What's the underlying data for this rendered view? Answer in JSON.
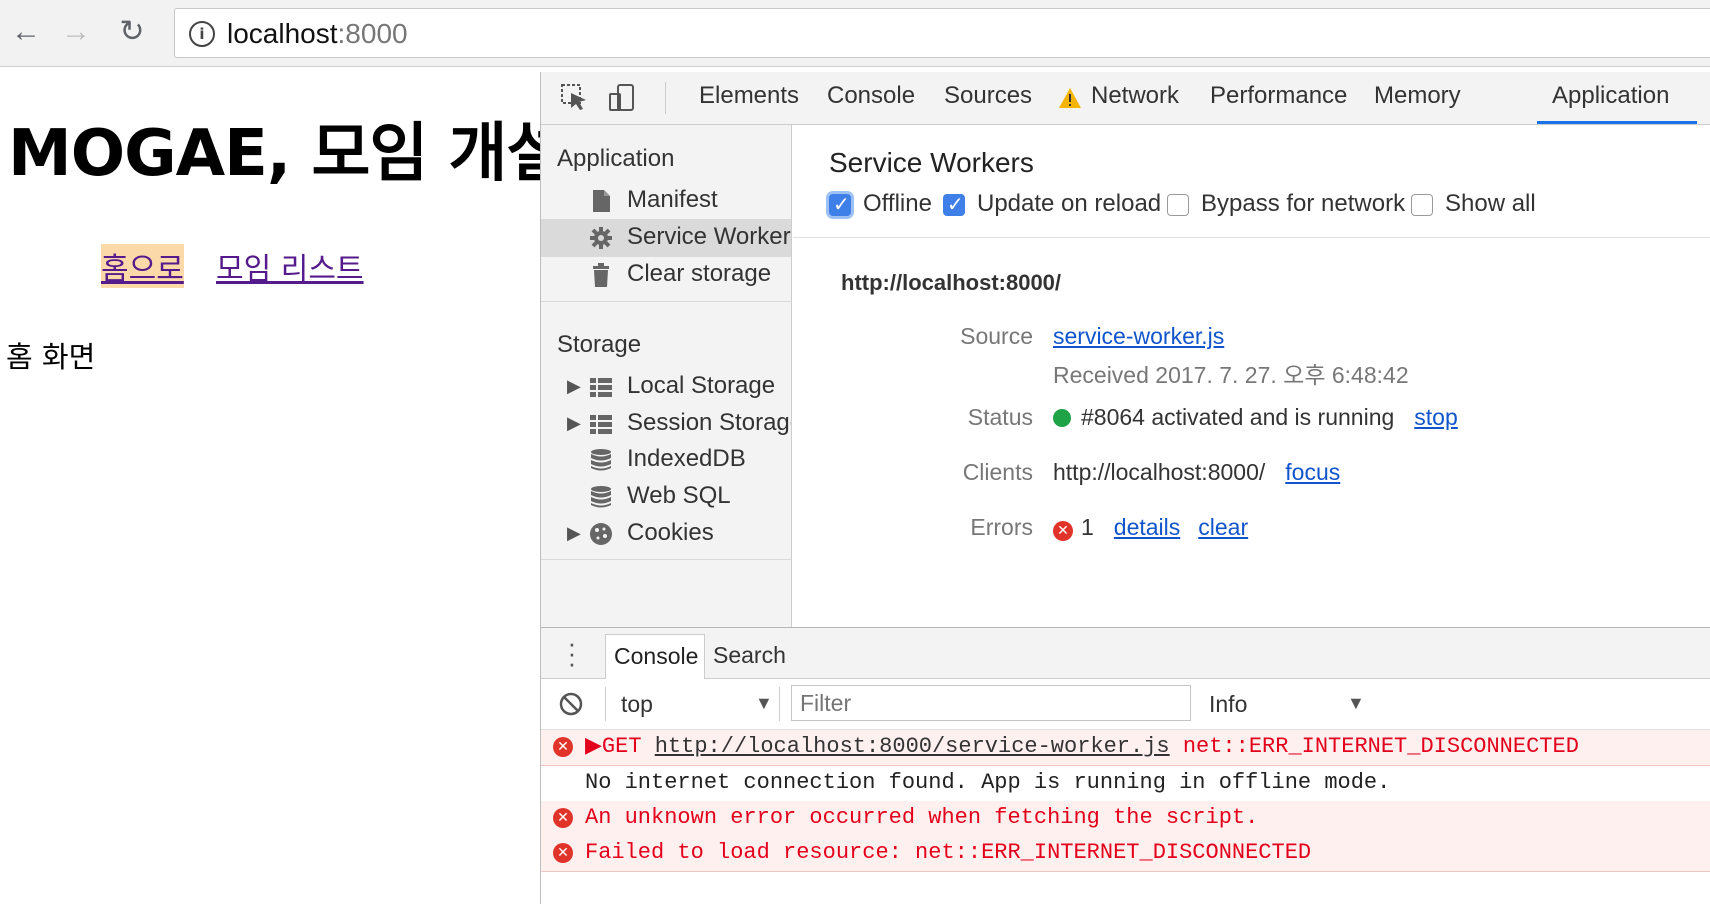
{
  "browser": {
    "url_host": "localhost",
    "url_port": ":8000"
  },
  "page": {
    "heading": "MOGAE, 모임 개설",
    "nav": [
      {
        "label": "홈으로"
      },
      {
        "label": "모임 리스트"
      }
    ],
    "body_text": "홈 화면"
  },
  "devtools": {
    "tabs": [
      "Elements",
      "Console",
      "Sources",
      "Network",
      "Performance",
      "Memory",
      "Application"
    ],
    "active_tab": "Application",
    "sidebar": {
      "application_heading": "Application",
      "application_items": [
        "Manifest",
        "Service Workers",
        "Clear storage"
      ],
      "storage_heading": "Storage",
      "storage_items": [
        "Local Storage",
        "Session Storage",
        "IndexedDB",
        "Web SQL",
        "Cookies"
      ]
    },
    "service_workers": {
      "title": "Service Workers",
      "options": [
        {
          "label": "Offline",
          "checked": true
        },
        {
          "label": "Update on reload",
          "checked": true
        },
        {
          "label": "Bypass for network",
          "checked": false
        },
        {
          "label": "Show all",
          "checked": false
        }
      ],
      "origin": "http://localhost:8000/",
      "source_label": "Source",
      "source_file": "service-worker.js",
      "received": "Received 2017. 7. 27. 오후 6:48:42",
      "status_label": "Status",
      "status_text": "#8064 activated and is running",
      "status_action": "stop",
      "clients_label": "Clients",
      "clients_url": "http://localhost:8000/",
      "clients_action": "focus",
      "errors_label": "Errors",
      "errors_count": "1",
      "errors_details": "details",
      "errors_clear": "clear"
    },
    "drawer": {
      "tabs": [
        "Console",
        "Search"
      ],
      "context": "top",
      "filter_placeholder": "Filter",
      "level": "Info",
      "messages": [
        {
          "type": "error",
          "prefix": "▶GET ",
          "link": "http://localhost:8000/service-worker.js",
          "suffix": " net::ERR_INTERNET_DISCONNECTED"
        },
        {
          "type": "log",
          "text": "No internet connection found. App is running in offline mode."
        },
        {
          "type": "error",
          "text": "An unknown error occurred when fetching the script."
        },
        {
          "type": "error",
          "text": "Failed to load resource: net::ERR_INTERNET_DISCONNECTED"
        }
      ]
    }
  },
  "colors": {
    "accent": "#1a73e8",
    "error_text": "#e3001b",
    "error_bg": "#fff0f0",
    "status_running": "#1ea446",
    "visited_link": "#551a8b"
  }
}
